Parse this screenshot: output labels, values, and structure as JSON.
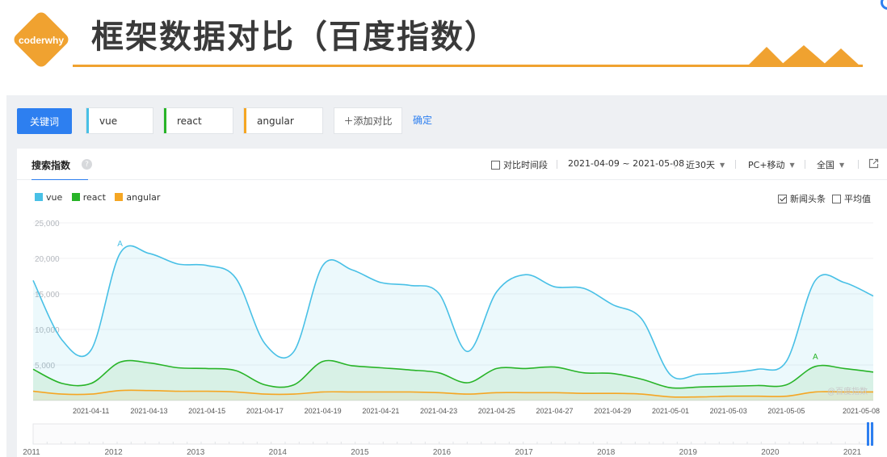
{
  "slide": {
    "logo_text": "coderwhy",
    "title": "框架数据对比（百度指数）"
  },
  "colors": {
    "accent_orange": "#f0a230",
    "baidu_blue": "#2d7ff0",
    "vue": "#48c0e6",
    "react": "#28b428",
    "angular": "#f5a623"
  },
  "keywords": {
    "button_label": "关键词",
    "items": [
      "vue",
      "react",
      "angular"
    ],
    "add_label": "＋添加对比",
    "confirm_label": "确定"
  },
  "card": {
    "title": "搜索指数",
    "help_icon": "question-icon",
    "compare_period_label": "对比时间段",
    "date_range": "2021-04-09 ~ 2021-05-08",
    "range_select": "近30天",
    "device_select": "PC+移动",
    "region_select": "全国",
    "export_icon": "external-link-icon",
    "news_label": "新闻头条",
    "news_checked": true,
    "average_label": "平均值",
    "average_checked": false,
    "watermark": "@百度指数"
  },
  "chart_data": {
    "type": "line",
    "x_dates": [
      "2021-04-09",
      "2021-04-10",
      "2021-04-11",
      "2021-04-12",
      "2021-04-13",
      "2021-04-14",
      "2021-04-15",
      "2021-04-16",
      "2021-04-17",
      "2021-04-18",
      "2021-04-19",
      "2021-04-20",
      "2021-04-21",
      "2021-04-22",
      "2021-04-23",
      "2021-04-24",
      "2021-04-25",
      "2021-04-26",
      "2021-04-27",
      "2021-04-28",
      "2021-04-29",
      "2021-04-30",
      "2021-05-01",
      "2021-05-02",
      "2021-05-03",
      "2021-05-04",
      "2021-05-05",
      "2021-05-06",
      "2021-05-07",
      "2021-05-08"
    ],
    "x_tick_labels": [
      "2021-04-11",
      "2021-04-13",
      "2021-04-15",
      "2021-04-17",
      "2021-04-19",
      "2021-04-21",
      "2021-04-23",
      "2021-04-25",
      "2021-04-27",
      "2021-04-29",
      "2021-05-01",
      "2021-05-03",
      "2021-05-05",
      "2021-05-08"
    ],
    "y_ticks": [
      5000,
      10000,
      15000,
      20000,
      25000
    ],
    "y_tick_labels": [
      "5,000",
      "10,000",
      "15,000",
      "20,000",
      "25,000"
    ],
    "ylim": [
      0,
      25000
    ],
    "grid": true,
    "legend_position": "top-left",
    "series": [
      {
        "name": "vue",
        "values": [
          16900,
          8500,
          7100,
          20700,
          20700,
          19200,
          19000,
          17200,
          8000,
          6900,
          19000,
          18400,
          16600,
          16200,
          15100,
          6900,
          15300,
          17700,
          16000,
          15800,
          13500,
          11500,
          3600,
          3700,
          3900,
          4400,
          5500,
          16900,
          16600,
          14700
        ]
      },
      {
        "name": "react",
        "values": [
          4400,
          2400,
          2400,
          5400,
          5300,
          4600,
          4500,
          4200,
          2200,
          2200,
          5500,
          4900,
          4600,
          4300,
          3900,
          2500,
          4500,
          4500,
          4700,
          3900,
          3800,
          3000,
          1800,
          1900,
          2000,
          2100,
          2200,
          4800,
          4500,
          4000
        ]
      },
      {
        "name": "angular",
        "values": [
          1300,
          900,
          900,
          1400,
          1400,
          1300,
          1300,
          1200,
          900,
          900,
          1200,
          1200,
          1200,
          1200,
          1100,
          900,
          1100,
          1100,
          1100,
          1000,
          1000,
          900,
          500,
          500,
          600,
          600,
          600,
          1200,
          1200,
          1200
        ]
      }
    ],
    "annotations": [
      {
        "label": "A",
        "series": "vue",
        "x": "2021-04-12"
      },
      {
        "label": "A",
        "series": "react",
        "x": "2021-05-06"
      }
    ],
    "overview": {
      "year_labels": [
        "2011",
        "2012",
        "2013",
        "2014",
        "2015",
        "2016",
        "2017",
        "2018",
        "2019",
        "2020",
        "2021"
      ]
    }
  }
}
